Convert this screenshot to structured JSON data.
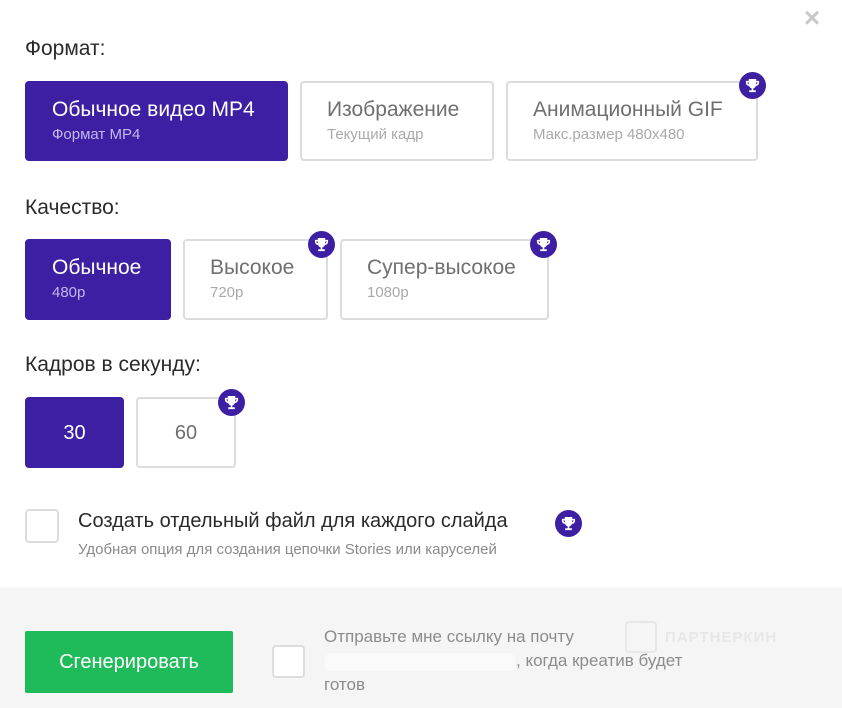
{
  "close_icon": "×",
  "format": {
    "title": "Формат:",
    "options": [
      {
        "title": "Обычное видео MP4",
        "subtitle": "Формат MP4",
        "selected": true,
        "premium": false
      },
      {
        "title": "Изображение",
        "subtitle": "Текущий кадр",
        "selected": false,
        "premium": false
      },
      {
        "title": "Анимационный GIF",
        "subtitle": "Макс.размер 480x480",
        "selected": false,
        "premium": true
      }
    ]
  },
  "quality": {
    "title": "Качество:",
    "options": [
      {
        "title": "Обычное",
        "subtitle": "480p",
        "selected": true,
        "premium": false
      },
      {
        "title": "Высокое",
        "subtitle": "720p",
        "selected": false,
        "premium": true
      },
      {
        "title": "Супер-высокое",
        "subtitle": "1080p",
        "selected": false,
        "premium": true
      }
    ]
  },
  "fps": {
    "title": "Кадров в секунду:",
    "options": [
      {
        "title": "30",
        "selected": true,
        "premium": false
      },
      {
        "title": "60",
        "selected": false,
        "premium": true
      }
    ]
  },
  "slides": {
    "label": "Создать отдельный файл для каждого слайда",
    "hint": "Удобная опция для создания цепочки Stories или каруселей",
    "checked": false,
    "premium": true
  },
  "footer": {
    "generate_label": "Сгенерировать",
    "email_checked": false,
    "email_text_before": "Отправьте мне ссылку на почту",
    "email_text_after": ", когда креатив будет готов",
    "watermark": "ПАРТНЕРКИН"
  },
  "colors": {
    "accent": "#3d1fa3",
    "generate": "#1fba5a",
    "border": "#dcdcdc"
  },
  "icons": {
    "premium": "trophy-icon",
    "close": "close-icon"
  }
}
